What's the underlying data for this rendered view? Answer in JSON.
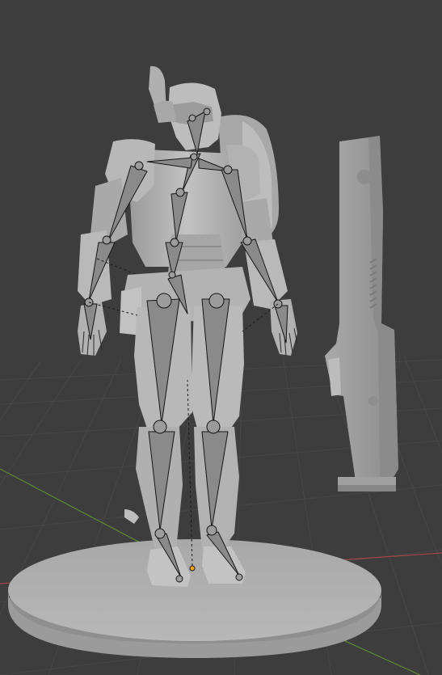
{
  "viewport": {
    "background_color": "#3d3d3d",
    "grid_color": "#4a4a4a",
    "x_axis_color": "#b24848",
    "y_axis_color": "#6f9a3a",
    "model_color": "#b5b5b5",
    "model_shadow_color": "#8a8a8a",
    "bone_color": "#8f8f8f",
    "bone_outline_color": "#1a1a1a"
  },
  "scene_objects": {
    "character": "armored-robot-figure",
    "armature": "humanoid-armature",
    "prop": "sword-weapon",
    "base": "circular-display-base",
    "origin_marker": "object-origin-dot"
  }
}
